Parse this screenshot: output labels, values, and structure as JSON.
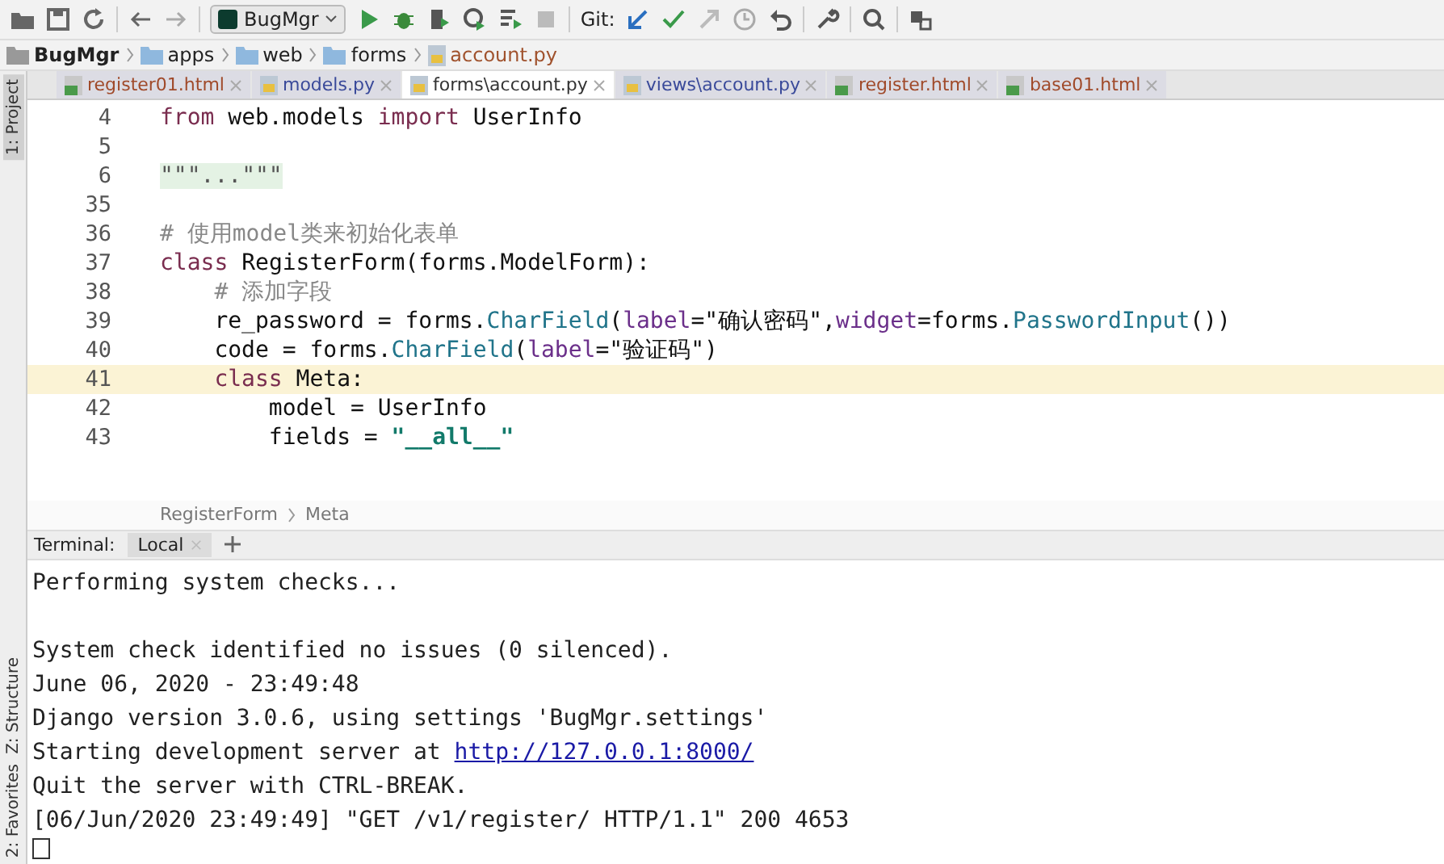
{
  "toolbar": {
    "run_config": "BugMgr",
    "git_label": "Git:"
  },
  "breadcrumb": [
    {
      "label": "BugMgr",
      "kind": "project"
    },
    {
      "label": "apps",
      "kind": "folder"
    },
    {
      "label": "web",
      "kind": "folder"
    },
    {
      "label": "forms",
      "kind": "folder"
    },
    {
      "label": "account.py",
      "kind": "file"
    }
  ],
  "side_panels": [
    {
      "label": "1: Project",
      "selected": true
    },
    {
      "label": "Z: Structure",
      "selected": false
    },
    {
      "label": "2: Favorites",
      "selected": false
    }
  ],
  "tabs": [
    {
      "label": "register01.html",
      "kind": "html",
      "selected": false,
      "color": "#a04a2a"
    },
    {
      "label": "models.py",
      "kind": "py",
      "selected": false,
      "color": "#3a4a9a"
    },
    {
      "label": "forms\\account.py",
      "kind": "py",
      "selected": true,
      "color": "#333333"
    },
    {
      "label": "views\\account.py",
      "kind": "py",
      "selected": false,
      "color": "#3a4a9a"
    },
    {
      "label": "register.html",
      "kind": "html",
      "selected": false,
      "color": "#a04a2a"
    },
    {
      "label": "base01.html",
      "kind": "html",
      "selected": false,
      "color": "#a04a2a"
    }
  ],
  "editor": {
    "lines": [
      {
        "number": "4",
        "current": false,
        "tokens": [
          {
            "kind": "kw",
            "text": "from"
          },
          {
            "kind": "plain",
            "text": " web.models "
          },
          {
            "kind": "kw",
            "text": "import"
          },
          {
            "kind": "plain",
            "text": " UserInfo"
          }
        ]
      },
      {
        "number": "5",
        "current": false
      },
      {
        "number": "6",
        "current": false,
        "tokens": [
          {
            "kind": "folded",
            "text": "\"\"\"...\"\"\""
          }
        ]
      },
      {
        "number": "35",
        "current": false
      },
      {
        "number": "36",
        "current": false,
        "tokens": [
          {
            "kind": "comment",
            "text": "# 使用model类来初始化表单"
          }
        ]
      },
      {
        "number": "37",
        "current": false,
        "tokens": [
          {
            "kind": "kw",
            "text": "class"
          },
          {
            "kind": "plain",
            "text": " RegisterForm(forms.ModelForm):"
          }
        ]
      },
      {
        "number": "38",
        "current": false,
        "kind": "body",
        "tokens": [
          {
            "kind": "comment",
            "text": "# 添加字段"
          }
        ]
      },
      {
        "number": "39",
        "current": false,
        "kind": "body",
        "tokens": [
          {
            "kind": "plain",
            "text": "re_password = forms."
          },
          {
            "kind": "call",
            "text": "CharField"
          },
          {
            "kind": "plain",
            "text": "("
          },
          {
            "kind": "param",
            "text": "label"
          },
          {
            "kind": "plain",
            "text": "=\"确认密码\","
          },
          {
            "kind": "param",
            "text": "widget"
          },
          {
            "kind": "plain",
            "text": "=forms."
          },
          {
            "kind": "call",
            "text": "PasswordInput"
          },
          {
            "kind": "plain",
            "text": "())"
          }
        ]
      },
      {
        "number": "40",
        "current": false,
        "kind": "body",
        "tokens": [
          {
            "kind": "plain",
            "text": "code = forms."
          },
          {
            "kind": "call",
            "text": "CharField"
          },
          {
            "kind": "plain",
            "text": "("
          },
          {
            "kind": "param",
            "text": "label"
          },
          {
            "kind": "plain",
            "text": "=\"验证码\")"
          }
        ]
      },
      {
        "number": "41",
        "current": true,
        "kind": "body",
        "tokens": [
          {
            "kind": "kw",
            "text": "class"
          },
          {
            "kind": "plain",
            "text": " Meta:"
          }
        ]
      },
      {
        "number": "42",
        "current": false,
        "kind": "nested",
        "tokens": [
          {
            "kind": "plain",
            "text": "model = UserInfo"
          }
        ]
      },
      {
        "number": "43",
        "current": false,
        "kind": "nested",
        "tokens": [
          {
            "kind": "plain",
            "text": "fields = "
          },
          {
            "kind": "str",
            "text": "\"__all__\""
          }
        ]
      }
    ],
    "breadcrumb": [
      "RegisterForm",
      "Meta"
    ]
  },
  "terminal": {
    "label": "Terminal:",
    "tabs": [
      {
        "label": "Local",
        "selected": true
      }
    ],
    "lines": [
      [
        {
          "kind": "plain",
          "text": "Performing system checks..."
        }
      ],
      [
        {
          "kind": "blank"
        }
      ],
      [
        {
          "kind": "plain",
          "text": "System check identified no issues (0 silenced)."
        }
      ],
      [
        {
          "kind": "plain",
          "text": "June 06, 2020 - 23:49:48"
        }
      ],
      [
        {
          "kind": "plain",
          "text": "Django version 3.0.6, using settings 'BugMgr.settings'"
        }
      ],
      [
        {
          "kind": "plain",
          "text": "Starting development server at "
        },
        {
          "kind": "link",
          "text": "http://127.0.0.1:8000/"
        }
      ],
      [
        {
          "kind": "plain",
          "text": "Quit the server with CTRL-BREAK."
        }
      ],
      [
        {
          "kind": "plain",
          "text": "[06/Jun/2020 23:49:49] \"GET /v1/register/ HTTP/1.1\" 200 4653"
        }
      ]
    ]
  }
}
